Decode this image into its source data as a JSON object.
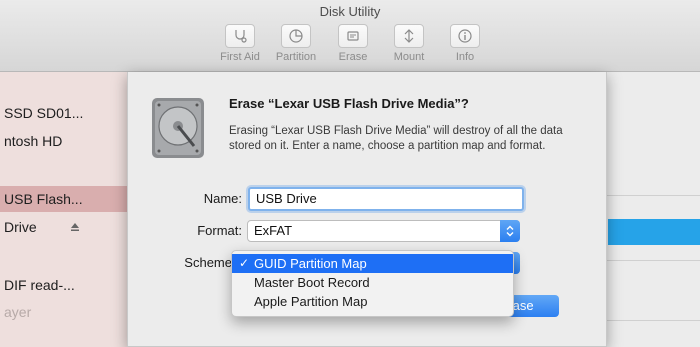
{
  "window": {
    "title": "Disk Utility"
  },
  "toolbar": {
    "items": [
      {
        "label": "First Aid",
        "icon": "stethoscope-icon"
      },
      {
        "label": "Partition",
        "icon": "partition-pie-icon"
      },
      {
        "label": "Erase",
        "icon": "erase-icon"
      },
      {
        "label": "Mount",
        "icon": "mount-icon"
      },
      {
        "label": "Info",
        "icon": "info-icon"
      }
    ]
  },
  "sidebar": {
    "items": [
      {
        "label": "SSD SD01..."
      },
      {
        "label": "ntosh HD"
      },
      {
        "label": "USB Flash..."
      },
      {
        "label": "Drive"
      },
      {
        "label": "DIF read-..."
      },
      {
        "label": "ayer"
      }
    ]
  },
  "sheet": {
    "title": "Erase “Lexar USB Flash Drive Media”?",
    "description": "Erasing “Lexar USB Flash Drive Media” will destroy of all the data stored on it. Enter a name, choose a partition map and format.",
    "name_label": "Name:",
    "name_value": "USB Drive",
    "format_label": "Format:",
    "format_value": "ExFAT",
    "scheme_label": "Scheme",
    "erase_label": "rase"
  },
  "scheme_menu": {
    "check": "✓",
    "options": [
      {
        "label": "GUID Partition Map",
        "selected": true
      },
      {
        "label": "Master Boot Record",
        "selected": false
      },
      {
        "label": "Apple Partition Map",
        "selected": false
      }
    ]
  },
  "colors": {
    "accent_blue": "#1e6ff5",
    "sidebar_selected": "#d9aeae",
    "sidebar_bg": "#eedfdd"
  }
}
